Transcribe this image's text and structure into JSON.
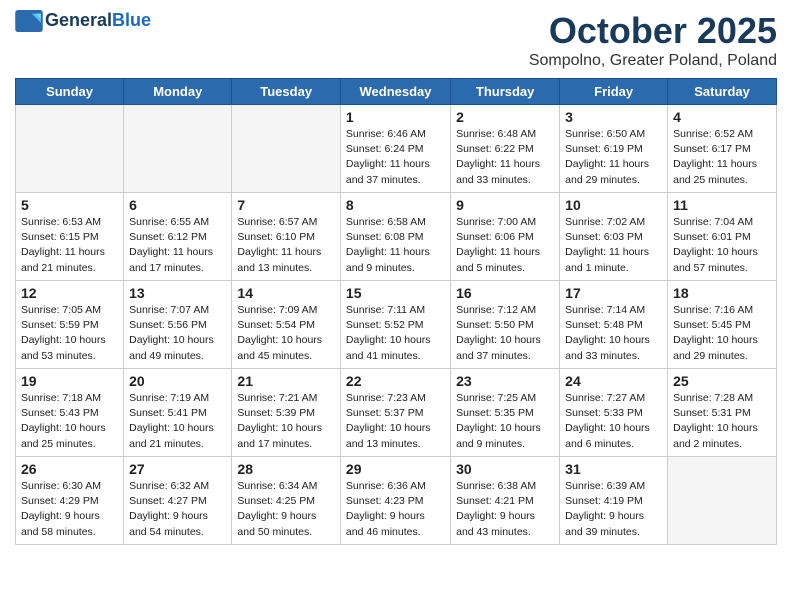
{
  "header": {
    "logo_line1": "General",
    "logo_line2": "Blue",
    "month": "October 2025",
    "location": "Sompolno, Greater Poland, Poland"
  },
  "weekdays": [
    "Sunday",
    "Monday",
    "Tuesday",
    "Wednesday",
    "Thursday",
    "Friday",
    "Saturday"
  ],
  "weeks": [
    [
      {
        "day": "",
        "empty": true
      },
      {
        "day": "",
        "empty": true
      },
      {
        "day": "",
        "empty": true
      },
      {
        "day": "1",
        "info": "Sunrise: 6:46 AM\nSunset: 6:24 PM\nDaylight: 11 hours and 37 minutes."
      },
      {
        "day": "2",
        "info": "Sunrise: 6:48 AM\nSunset: 6:22 PM\nDaylight: 11 hours and 33 minutes."
      },
      {
        "day": "3",
        "info": "Sunrise: 6:50 AM\nSunset: 6:19 PM\nDaylight: 11 hours and 29 minutes."
      },
      {
        "day": "4",
        "info": "Sunrise: 6:52 AM\nSunset: 6:17 PM\nDaylight: 11 hours and 25 minutes."
      }
    ],
    [
      {
        "day": "5",
        "info": "Sunrise: 6:53 AM\nSunset: 6:15 PM\nDaylight: 11 hours and 21 minutes."
      },
      {
        "day": "6",
        "info": "Sunrise: 6:55 AM\nSunset: 6:12 PM\nDaylight: 11 hours and 17 minutes."
      },
      {
        "day": "7",
        "info": "Sunrise: 6:57 AM\nSunset: 6:10 PM\nDaylight: 11 hours and 13 minutes."
      },
      {
        "day": "8",
        "info": "Sunrise: 6:58 AM\nSunset: 6:08 PM\nDaylight: 11 hours and 9 minutes."
      },
      {
        "day": "9",
        "info": "Sunrise: 7:00 AM\nSunset: 6:06 PM\nDaylight: 11 hours and 5 minutes."
      },
      {
        "day": "10",
        "info": "Sunrise: 7:02 AM\nSunset: 6:03 PM\nDaylight: 11 hours and 1 minute."
      },
      {
        "day": "11",
        "info": "Sunrise: 7:04 AM\nSunset: 6:01 PM\nDaylight: 10 hours and 57 minutes."
      }
    ],
    [
      {
        "day": "12",
        "info": "Sunrise: 7:05 AM\nSunset: 5:59 PM\nDaylight: 10 hours and 53 minutes."
      },
      {
        "day": "13",
        "info": "Sunrise: 7:07 AM\nSunset: 5:56 PM\nDaylight: 10 hours and 49 minutes."
      },
      {
        "day": "14",
        "info": "Sunrise: 7:09 AM\nSunset: 5:54 PM\nDaylight: 10 hours and 45 minutes."
      },
      {
        "day": "15",
        "info": "Sunrise: 7:11 AM\nSunset: 5:52 PM\nDaylight: 10 hours and 41 minutes."
      },
      {
        "day": "16",
        "info": "Sunrise: 7:12 AM\nSunset: 5:50 PM\nDaylight: 10 hours and 37 minutes."
      },
      {
        "day": "17",
        "info": "Sunrise: 7:14 AM\nSunset: 5:48 PM\nDaylight: 10 hours and 33 minutes."
      },
      {
        "day": "18",
        "info": "Sunrise: 7:16 AM\nSunset: 5:45 PM\nDaylight: 10 hours and 29 minutes."
      }
    ],
    [
      {
        "day": "19",
        "info": "Sunrise: 7:18 AM\nSunset: 5:43 PM\nDaylight: 10 hours and 25 minutes."
      },
      {
        "day": "20",
        "info": "Sunrise: 7:19 AM\nSunset: 5:41 PM\nDaylight: 10 hours and 21 minutes."
      },
      {
        "day": "21",
        "info": "Sunrise: 7:21 AM\nSunset: 5:39 PM\nDaylight: 10 hours and 17 minutes."
      },
      {
        "day": "22",
        "info": "Sunrise: 7:23 AM\nSunset: 5:37 PM\nDaylight: 10 hours and 13 minutes."
      },
      {
        "day": "23",
        "info": "Sunrise: 7:25 AM\nSunset: 5:35 PM\nDaylight: 10 hours and 9 minutes."
      },
      {
        "day": "24",
        "info": "Sunrise: 7:27 AM\nSunset: 5:33 PM\nDaylight: 10 hours and 6 minutes."
      },
      {
        "day": "25",
        "info": "Sunrise: 7:28 AM\nSunset: 5:31 PM\nDaylight: 10 hours and 2 minutes."
      }
    ],
    [
      {
        "day": "26",
        "info": "Sunrise: 6:30 AM\nSunset: 4:29 PM\nDaylight: 9 hours and 58 minutes."
      },
      {
        "day": "27",
        "info": "Sunrise: 6:32 AM\nSunset: 4:27 PM\nDaylight: 9 hours and 54 minutes."
      },
      {
        "day": "28",
        "info": "Sunrise: 6:34 AM\nSunset: 4:25 PM\nDaylight: 9 hours and 50 minutes."
      },
      {
        "day": "29",
        "info": "Sunrise: 6:36 AM\nSunset: 4:23 PM\nDaylight: 9 hours and 46 minutes."
      },
      {
        "day": "30",
        "info": "Sunrise: 6:38 AM\nSunset: 4:21 PM\nDaylight: 9 hours and 43 minutes."
      },
      {
        "day": "31",
        "info": "Sunrise: 6:39 AM\nSunset: 4:19 PM\nDaylight: 9 hours and 39 minutes."
      },
      {
        "day": "",
        "empty": true
      }
    ]
  ]
}
